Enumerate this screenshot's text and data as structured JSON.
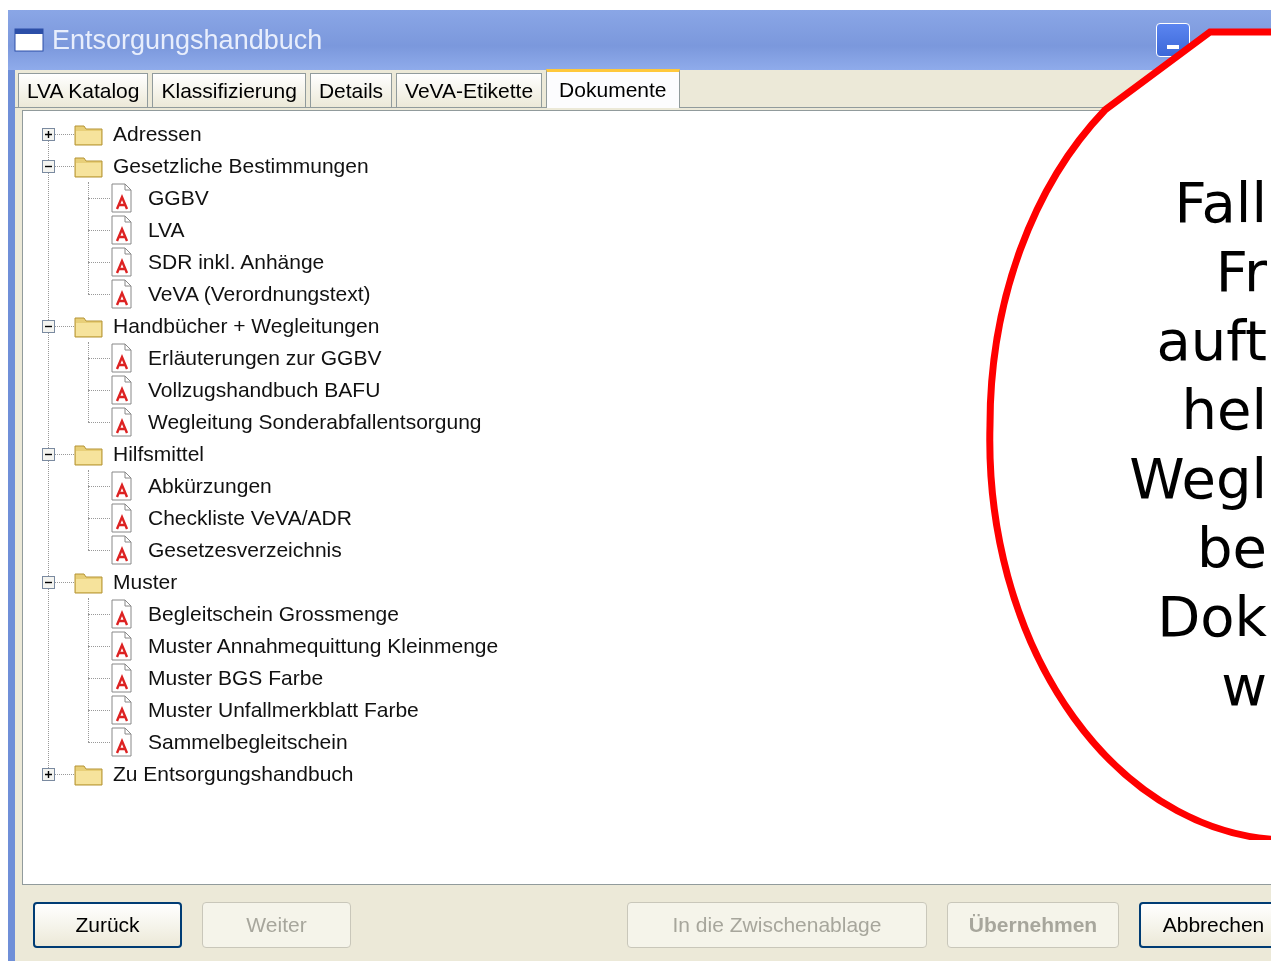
{
  "window": {
    "title": "Entsorgungshandbuch"
  },
  "tabs": [
    {
      "label": "LVA Katalog",
      "selected": false
    },
    {
      "label": "Klassifizierung",
      "selected": false
    },
    {
      "label": "Details",
      "selected": false
    },
    {
      "label": "VeVA-Etikette",
      "selected": false
    },
    {
      "label": "Dokumente",
      "selected": true
    }
  ],
  "tree": [
    {
      "label": "Adressen",
      "kind": "folder",
      "expanded": false
    },
    {
      "label": "Gesetzliche Bestimmungen",
      "kind": "folder",
      "expanded": true,
      "children": [
        {
          "label": "GGBV",
          "kind": "pdf"
        },
        {
          "label": "LVA",
          "kind": "pdf"
        },
        {
          "label": "SDR inkl. Anhänge",
          "kind": "pdf"
        },
        {
          "label": "VeVA (Verordnungstext)",
          "kind": "pdf"
        }
      ]
    },
    {
      "label": "Handbücher + Wegleitungen",
      "kind": "folder",
      "expanded": true,
      "children": [
        {
          "label": "Erläuterungen zur GGBV",
          "kind": "pdf"
        },
        {
          "label": "Vollzugshandbuch BAFU",
          "kind": "pdf"
        },
        {
          "label": "Wegleitung Sonderabfallentsorgung",
          "kind": "pdf"
        }
      ]
    },
    {
      "label": "Hilfsmittel",
      "kind": "folder",
      "expanded": true,
      "children": [
        {
          "label": "Abkürzungen",
          "kind": "pdf"
        },
        {
          "label": "Checkliste VeVA/ADR",
          "kind": "pdf"
        },
        {
          "label": "Gesetzesverzeichnis",
          "kind": "pdf"
        }
      ]
    },
    {
      "label": "Muster",
      "kind": "folder",
      "expanded": true,
      "children": [
        {
          "label": "Begleitschein Grossmenge",
          "kind": "pdf"
        },
        {
          "label": "Muster Annahmequittung Kleinmenge",
          "kind": "pdf"
        },
        {
          "label": "Muster BGS Farbe",
          "kind": "pdf"
        },
        {
          "label": "Muster Unfallmerkblatt Farbe",
          "kind": "pdf"
        },
        {
          "label": "Sammelbegleitschein",
          "kind": "pdf"
        }
      ]
    },
    {
      "label": "Zu Entsorgungshandbuch",
      "kind": "folder",
      "expanded": false
    }
  ],
  "buttons": [
    {
      "label": "Zurück",
      "kind": "normal",
      "disabled": false
    },
    {
      "label": "Weiter",
      "kind": "normal",
      "disabled": true
    },
    {
      "label": "In die Zwischenablage",
      "kind": "normal",
      "disabled": true
    },
    {
      "label": "Übernehmen",
      "kind": "primary",
      "disabled": true
    },
    {
      "label": "Abbrechen",
      "kind": "normal",
      "disabled": false
    }
  ],
  "callout": {
    "lines": [
      "Fall",
      "Fr",
      "auft",
      "hel",
      "Wegl",
      "be",
      "Dok",
      "w"
    ]
  }
}
